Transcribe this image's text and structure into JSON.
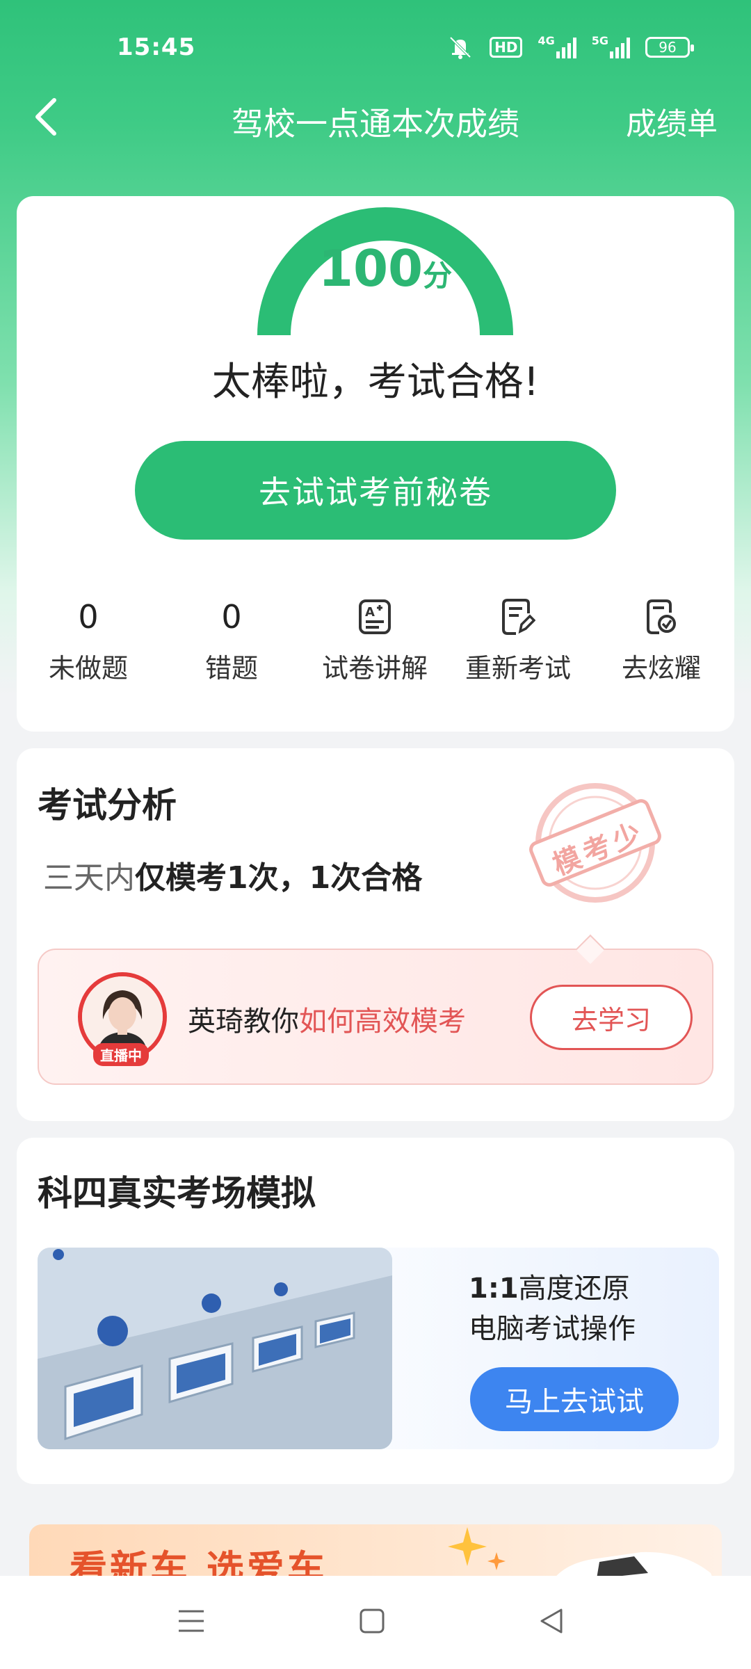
{
  "status_bar": {
    "time": "15:45",
    "hd_label": "HD",
    "signal1_label": "4G",
    "signal2_label": "5G",
    "battery": "96"
  },
  "nav": {
    "title": "驾校一点通本次成绩",
    "right_label": "成绩单",
    "back_icon": "chevron-left-icon"
  },
  "score_card": {
    "score": "100",
    "unit": "分",
    "result": "太棒啦，考试合格!",
    "primary_button": "去试试考前秘卷",
    "stats": [
      {
        "value": "0",
        "label": "未做题"
      },
      {
        "value": "0",
        "label": "错题"
      },
      {
        "icon": "exam-explain-icon",
        "label": "试卷讲解"
      },
      {
        "icon": "retake-exam-icon",
        "label": "重新考试"
      },
      {
        "icon": "show-off-icon",
        "label": "去炫耀"
      }
    ],
    "accent_color": "#2bbd75"
  },
  "analysis": {
    "title": "考试分析",
    "line_light": "三天内",
    "line_strong": "仅模考1次，1次合格",
    "stamp_text": "模考少",
    "promo_text": "英琦教你",
    "promo_accent": "如何高效模考",
    "live_badge": "直播中",
    "learn_button": "去学习"
  },
  "simulation": {
    "title": "科四真实考场模拟",
    "line1_bold": "1:1",
    "line1_rest": "高度还原",
    "line2": "电脑考试操作",
    "button": "马上去试试"
  },
  "ad": {
    "text": "看新车 选爱车"
  }
}
